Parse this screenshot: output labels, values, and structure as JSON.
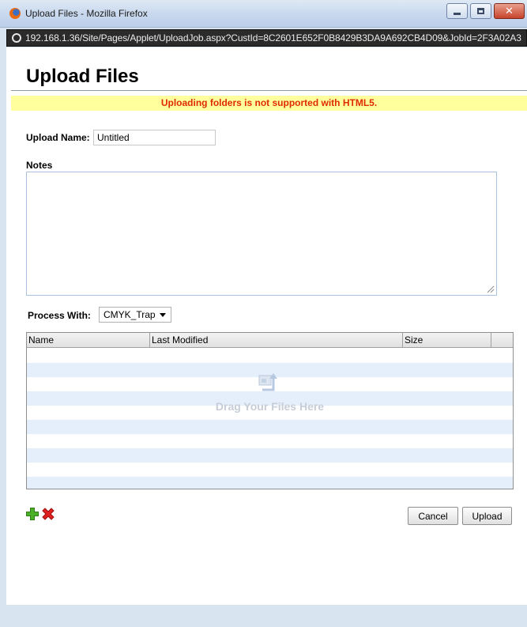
{
  "window": {
    "title": "Upload Files - Mozilla Firefox",
    "url": "192.168.1.36/Site/Pages/Applet/UploadJob.aspx?CustId=8C2601E652F0B8429B3DA9A692CB4D09&JobId=2F3A02A3"
  },
  "page": {
    "title": "Upload Files",
    "notice": "Uploading folders is not supported with HTML5."
  },
  "form": {
    "upload_name_label": "Upload Name:",
    "upload_name_value": "Untitled",
    "notes_label": "Notes",
    "notes_value": "",
    "process_label": "Process With:",
    "process_selected": "CMYK_Trap"
  },
  "files_grid": {
    "columns": [
      "Name",
      "Last Modified",
      "Size",
      ""
    ],
    "drop_text": "Drag Your Files Here",
    "rows": []
  },
  "actions": {
    "cancel_label": "Cancel",
    "upload_label": "Upload"
  },
  "icons": {
    "browser": "firefox-icon",
    "url": "globe-icon",
    "add": "plus-icon",
    "remove": "x-icon",
    "drop": "upload-image-icon"
  },
  "colors": {
    "notice_bg": "#ffff9e",
    "notice_text": "#e02b00",
    "row_alt": "#e5eefb",
    "add_green": "#4caf2a",
    "remove_red": "#e02020"
  }
}
